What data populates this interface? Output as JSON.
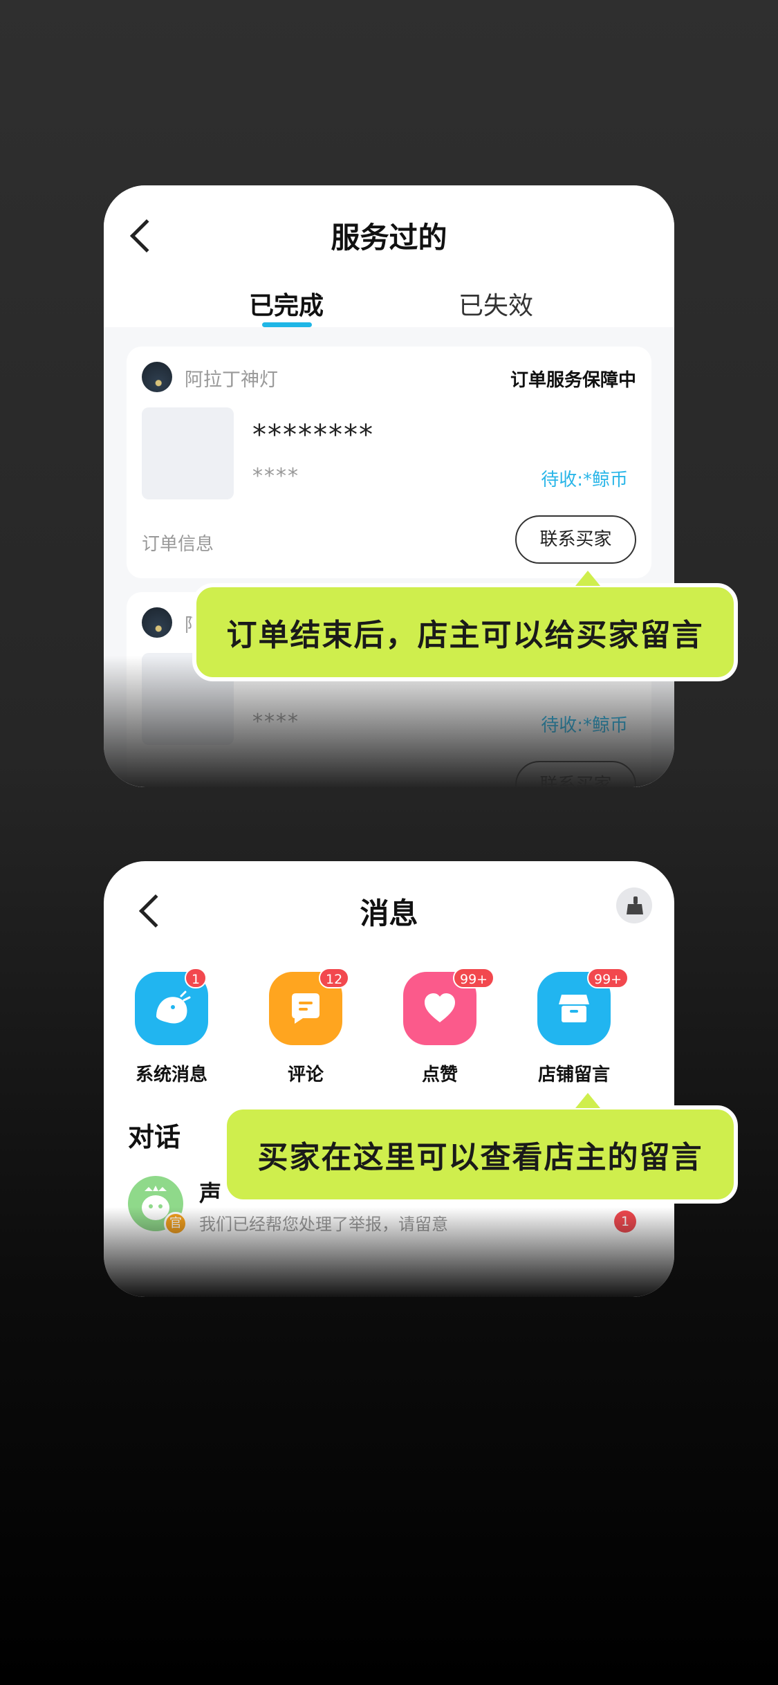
{
  "service_screen": {
    "title": "服务过的",
    "tabs": [
      {
        "label": "已完成",
        "active": true
      },
      {
        "label": "已失效",
        "active": false
      }
    ],
    "orders": [
      {
        "shop_name": "阿拉丁神灯",
        "status": "订单服务保障中",
        "product_name": "********",
        "product_sub": "****",
        "price": "待收:*鲸币",
        "info_label": "订单信息",
        "action_label": "联系买家"
      },
      {
        "shop_name": "阿",
        "product_sub": "****",
        "price": "待收:*鲸币",
        "action_label": "联系买家"
      }
    ]
  },
  "tooltip_1": "订单结束后，店主可以给买家留言",
  "message_screen": {
    "title": "消息",
    "categories": [
      {
        "label": "系统消息",
        "badge": "1",
        "color": "#21b5f0",
        "icon": "bird-icon"
      },
      {
        "label": "评论",
        "badge": "12",
        "color": "#ffa51f",
        "icon": "comment-icon"
      },
      {
        "label": "点赞",
        "badge": "99+",
        "color": "#fb5a8b",
        "icon": "heart-icon"
      },
      {
        "label": "店铺留言",
        "badge": "99+",
        "color": "#21b5f0",
        "icon": "shop-icon"
      }
    ],
    "section_title": "对话",
    "conversation": {
      "name": "声",
      "official_badge": "官",
      "preview": "我们已经帮您处理了举报，请留意",
      "unread": "1"
    }
  },
  "tooltip_2": "买家在这里可以查看店主的留言"
}
